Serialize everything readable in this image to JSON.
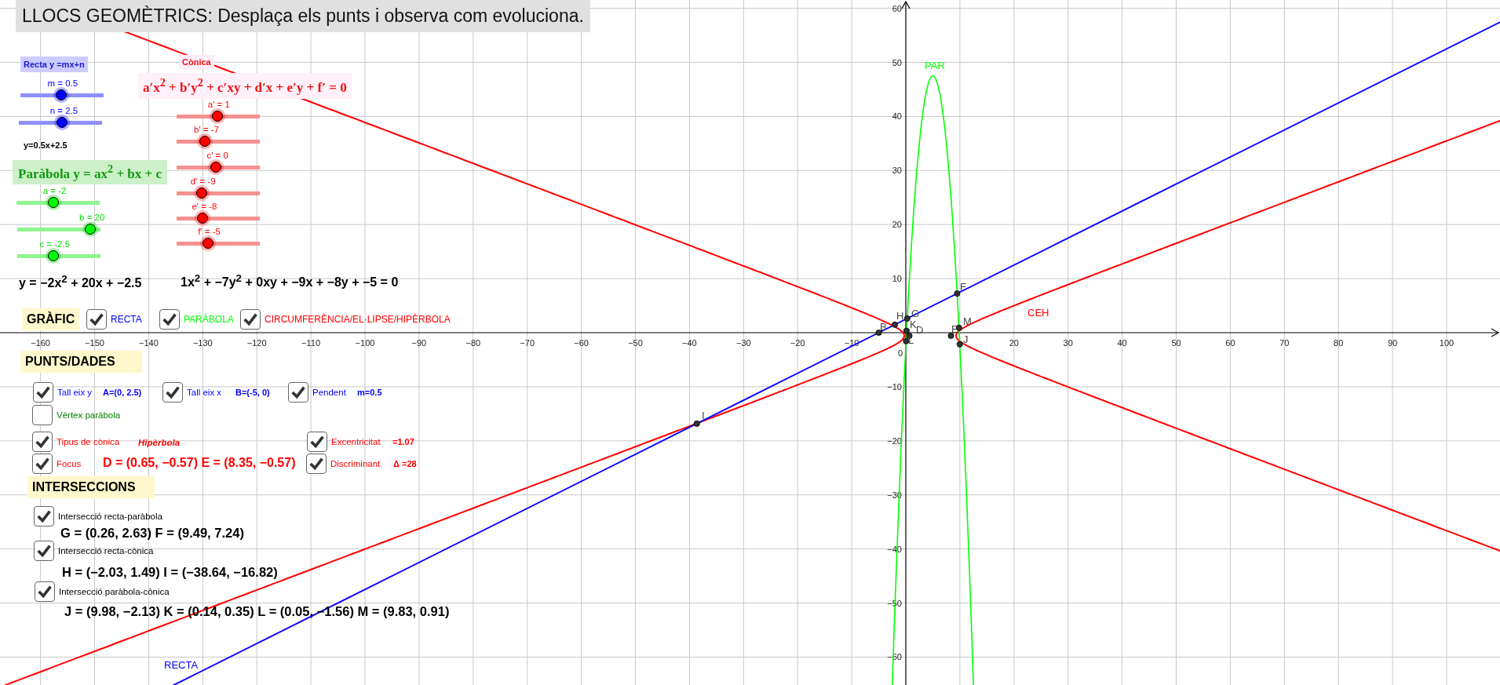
{
  "title": "LLOCS GEOMÈTRICS: Desplaça els punts i observa com evoluciona.",
  "line_panel": {
    "heading": "Recta y =mx+n",
    "sliders": [
      {
        "label": "m = 0.5",
        "level": 0.51
      },
      {
        "label": "n = 2.5",
        "level": 0.55
      }
    ],
    "equation": "y=0.5x+2.5"
  },
  "parabola_panel": {
    "heading": "Paràbola y = ax$^{2}$ + bx + c",
    "sliders": [
      {
        "label": "a = -2",
        "level": 0.45
      },
      {
        "label": "b = 20",
        "level": 0.98
      },
      {
        "label": "c = -2.5",
        "level": 0.44
      }
    ],
    "equation": "y = −2x$^{2}$ + 20x + −2.5"
  },
  "conic_panel": {
    "heading": "Cònica",
    "formula": "a′x$^{2}$ + b′y$^{2}$ + c′xy + d′x + e′y + f′ = 0",
    "sliders": [
      {
        "label": "a' = 1",
        "level": 0.51
      },
      {
        "label": "b' = -7",
        "level": 0.33
      },
      {
        "label": "c' = 0",
        "level": 0.49
      },
      {
        "label": "d' = -9",
        "level": 0.28
      },
      {
        "label": "e' = -8",
        "level": 0.3
      },
      {
        "label": "f' = -5",
        "level": 0.37
      }
    ],
    "equation": "1x$^{2}$ + −7y$^{2}$ + 0xy + −9x + −8y + −5 = 0"
  },
  "graph_section": {
    "heading": "GRÀFIC",
    "toggles": [
      {
        "label": "RECTA",
        "checked": true,
        "color": "#0000ff"
      },
      {
        "label": "PARÀBOLA",
        "checked": true,
        "color": "#00ff00"
      },
      {
        "label": "CIRCUMFERÈNCIA/EL·LIPSE/HIPÈRBOLA",
        "checked": true,
        "color": "#ff0000"
      }
    ]
  },
  "points_section": {
    "heading": "PUNTS/DADES",
    "items": [
      {
        "label": "Tall eix y",
        "checked": true,
        "color": "#0000ff",
        "kind": "reading",
        "value": "A=(0, 2.5)"
      },
      {
        "label": "Tall eix x",
        "checked": true,
        "color": "#0000ff",
        "kind": "reading",
        "value": "B=(-5, 0)"
      },
      {
        "label": "Pendent",
        "checked": true,
        "color": "#0000ff",
        "kind": "reading",
        "value": "m=0.5"
      },
      {
        "label": "Vèrtex paràbola",
        "checked": false,
        "color": "#008000",
        "kind": "none"
      },
      {
        "label": "Tipus de cònica",
        "checked": true,
        "color": "#ff0000",
        "kind": "type",
        "value": "Hipèrbola"
      },
      {
        "label": "Excentricitat",
        "checked": true,
        "color": "#ff0000",
        "kind": "reading",
        "value": "=1.07"
      },
      {
        "label": "Focus",
        "checked": true,
        "color": "#ff0000",
        "kind": "formula",
        "value": "D = (0.65, −0.57) E = (8.35, −0.57)"
      },
      {
        "label": "Discriminant",
        "checked": true,
        "color": "#ff0000",
        "kind": "reading",
        "value": "Δ =28"
      }
    ]
  },
  "intersections_section": {
    "heading": "INTERSECCIONS",
    "items": [
      {
        "label": "Intersecció recta-paràbola",
        "checked": true,
        "result": "G = (0.26, 2.63)  F = (9.49, 7.24)"
      },
      {
        "label": "Intersecció recta-cònica",
        "checked": true,
        "result": "H = (−2.03, 1.49)  I = (−38.64, −16.82)"
      },
      {
        "label": "Intersecció paràbola-cònica",
        "checked": true,
        "result": "J = (9.98, −2.13) K = (0.14, 0.35) L = (0.05, −1.56) M = (9.83, 0.91)"
      }
    ]
  },
  "graph": {
    "x_labels": [
      "−160",
      "−150",
      "−140",
      "−130",
      "−120",
      "−110",
      "−100",
      "−90",
      "−80",
      "−70",
      "−60",
      "−50",
      "−40",
      "−30",
      "−20",
      "−10",
      "0",
      "20",
      "30",
      "40",
      "50",
      "60",
      "70",
      "80",
      "90",
      "100"
    ],
    "y_labels": [
      "60",
      "50",
      "40",
      "30",
      "20",
      "10",
      "−10",
      "−20",
      "−30",
      "−40",
      "−50",
      "−60"
    ],
    "curve_labels": [
      {
        "label": "RECTA",
        "color": "#0000ff"
      },
      {
        "label": "PAR",
        "color": "#00ff00"
      },
      {
        "label": "CEH",
        "color": "#ff0000"
      }
    ],
    "point_labels": [
      "B",
      "H",
      "G",
      "K",
      "D",
      "L",
      "F",
      "M",
      "E",
      "J",
      "I"
    ]
  }
}
